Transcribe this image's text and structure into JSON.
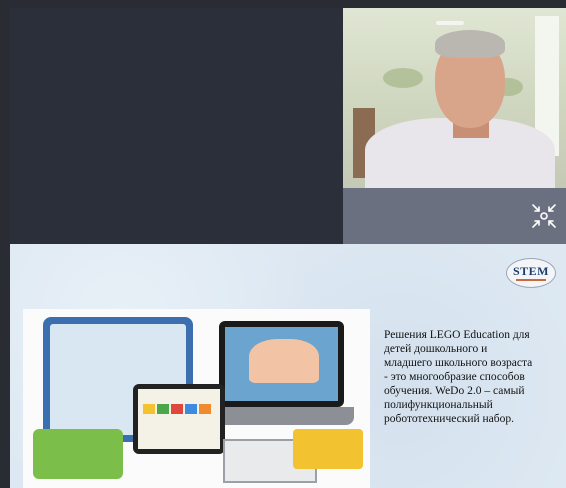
{
  "stem_logo": "STEM",
  "description_lines": [
    "Решения LEGO Education для",
    "детей        дошкольного      и",
    "младшего школьного возраста",
    "- это многообразие способов",
    "обучения. WeDo 2.0 – самый",
    "полифункциональный",
    "робототехнический набор."
  ],
  "icons": {
    "collapse": "collapse-arrows-icon"
  },
  "colors": {
    "dark_panel": "#2b2f3a",
    "cam_bar": "#6b7080",
    "slide_bg": "#dde8f2"
  }
}
